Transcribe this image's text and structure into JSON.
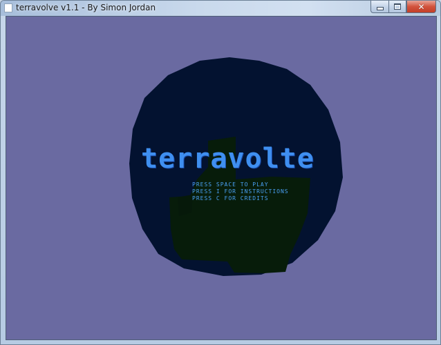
{
  "window": {
    "title": "terravolve v1.1 - By Simon Jordan",
    "minimize_glyph": "",
    "maximize_glyph": "",
    "close_glyph": "✕"
  },
  "game": {
    "logo_text": "terravolte",
    "menu": [
      "PRESS SPACE TO PLAY",
      "PRESS I FOR INSTRUCTIONS",
      "PRESS C FOR CREDITS"
    ]
  },
  "colors": {
    "background": "#6a6aa1",
    "planet": "#031230",
    "land": "#071c0a",
    "logo": "#3f8ff0",
    "menu_text": "#4aa0f4"
  }
}
